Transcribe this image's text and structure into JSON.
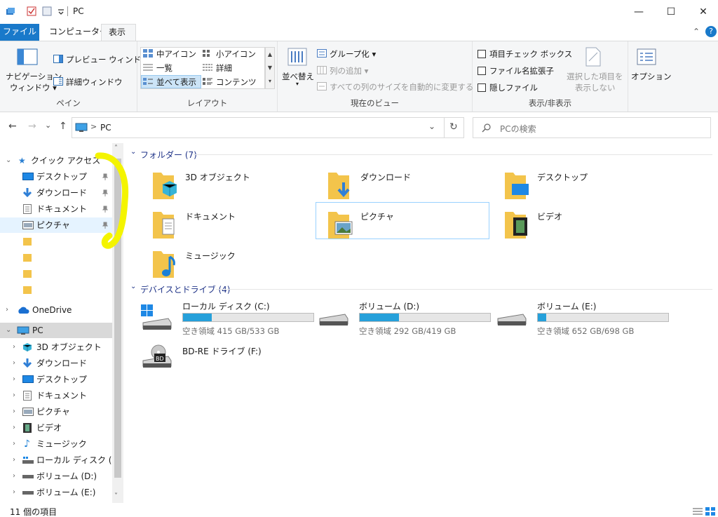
{
  "window": {
    "title": "PC",
    "minimize_glyph": "—",
    "maximize_glyph": "☐",
    "close_glyph": "✕"
  },
  "tabs": {
    "file": "ファイル",
    "computer": "コンピューター",
    "view": "表示",
    "collapse_glyph": "⌃",
    "help_glyph": "?"
  },
  "ribbon": {
    "pane": {
      "nav_pane_line1": "ナビゲーション",
      "nav_pane_line2": "ウィンドウ ▾",
      "preview": "プレビュー ウィンドウ",
      "details": "詳細ウィンドウ",
      "label": "ペイン"
    },
    "layout": {
      "medium_icons": "中アイコン",
      "small_icons": "小アイコン",
      "list": "一覧",
      "details": "詳細",
      "tiles": "並べて表示",
      "content": "コンテンツ",
      "label": "レイアウト"
    },
    "current_view": {
      "sort": "並べ替え",
      "group": "グループ化 ▾",
      "add_column": "列の追加 ▾",
      "fit_columns": "すべての列のサイズを自動的に変更する",
      "label": "現在のビュー"
    },
    "show_hide": {
      "item_checkboxes": "項目チェック ボックス",
      "file_ext": "ファイル名拡張子",
      "hidden_items": "隠しファイル",
      "hide_selected_line1": "選択した項目を",
      "hide_selected_line2": "表示しない",
      "label": "表示/非表示"
    },
    "options": "オプション"
  },
  "navbar": {
    "back": "←",
    "forward": "→",
    "recent": "⌄",
    "up": "↑",
    "path_sep": ">",
    "path": "PC",
    "dropdown": "⌄",
    "refresh": "↻",
    "search_placeholder": "PCの検索"
  },
  "navpane": {
    "quick_access": "クイック アクセス",
    "qa_items": [
      "デスクトップ",
      "ダウンロード",
      "ドキュメント",
      "ピクチャ"
    ],
    "onedrive": "OneDrive",
    "pc": "PC",
    "pc_items": [
      "3D オブジェクト",
      "ダウンロード",
      "デスクトップ",
      "ドキュメント",
      "ピクチャ",
      "ビデオ",
      "ミュージック",
      "ローカル ディスク (C:)",
      "ボリューム (D:)",
      "ボリューム (E:)"
    ]
  },
  "content": {
    "folders_header": "フォルダー (7)",
    "folders": [
      "3D オブジェクト",
      "ダウンロード",
      "デスクトップ",
      "ドキュメント",
      "ピクチャ",
      "ビデオ",
      "ミュージック"
    ],
    "drives_header": "デバイスとドライブ (4)",
    "drives": [
      {
        "name": "ローカル ディスク (C:)",
        "free": "空き領域 415 GB/533 GB",
        "used_fraction": 0.221
      },
      {
        "name": "ボリューム (D:)",
        "free": "空き領域 292 GB/419 GB",
        "used_fraction": 0.303
      },
      {
        "name": "ボリューム (E:)",
        "free": "空き領域 652 GB/698 GB",
        "used_fraction": 0.066
      }
    ],
    "bd_drive": "BD-RE ドライブ (F:)"
  },
  "status": {
    "items": "11 個の項目"
  },
  "colors": {
    "accent": "#1979ca",
    "progress": "#26a0da",
    "folder": "#f3c44b",
    "highlight": "#f4f400"
  }
}
